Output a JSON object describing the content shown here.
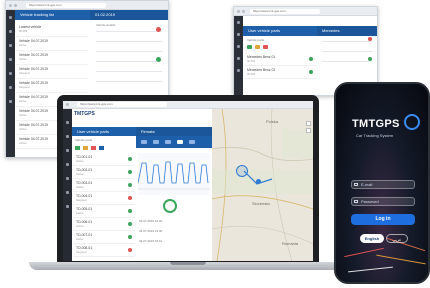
{
  "brand": {
    "logo_text": "TMTGPS",
    "tagline": "Car Tracking System",
    "accent": "#1d5fa8",
    "phone_accent": "#1e6ee0"
  },
  "window_left": {
    "url": "https://www.tmt-gps.com",
    "header_title": "Vehicle tracking list",
    "header_right": "01.02.2019",
    "panel_title": "Vehicle details",
    "rows": [
      {
        "title": "Lowest vehicle",
        "sub": "ID 004"
      },
      {
        "title": "Vehicle 04.07.2019",
        "sub": "Active"
      },
      {
        "title": "Vehicle 04.07.2019",
        "sub": "Active"
      },
      {
        "title": "Vehicle 04.07.2019",
        "sub": "Stopped"
      },
      {
        "title": "Vehicle 04.07.2019",
        "sub": "Stopped"
      },
      {
        "title": "Vehicle 04.07.2019",
        "sub": "Active"
      },
      {
        "title": "Vehicle 04.07.2019",
        "sub": "Active"
      },
      {
        "title": "Vehicle 04.07.2019",
        "sub": "Active"
      },
      {
        "title": "Vehicle 04.07.2019",
        "sub": "Active"
      }
    ]
  },
  "window_right": {
    "url": "https://www.tmt-gps.com",
    "header_title": "User vehicle parts",
    "header_title_2": "Mercedes",
    "filter_label": "Vehicle parts",
    "rows": [
      {
        "title": "Mercedes Benz 01",
        "sub": "ID 001"
      },
      {
        "title": "Mercedes Benz 02",
        "sub": "ID 002"
      }
    ]
  },
  "laptop": {
    "url": "https://www.tmt-gps.com",
    "panel_title": "User vehicle parts",
    "list_header": "Vehicle parts",
    "chart_title": "Firmata",
    "map_labels": [
      "Polska",
      "Slovensko",
      "Romania"
    ],
    "rows": [
      {
        "title": "TD-001-01",
        "sub": "Active"
      },
      {
        "title": "TD-002-01",
        "sub": "Active"
      },
      {
        "title": "TD-003-01",
        "sub": "Active"
      },
      {
        "title": "TD-004-01",
        "sub": "Stopped"
      },
      {
        "title": "TD-005-01",
        "sub": "Active"
      },
      {
        "title": "TD-006-01",
        "sub": "Active"
      },
      {
        "title": "TD-007-01",
        "sub": "Active"
      },
      {
        "title": "TD-008-01",
        "sub": "Stopped"
      }
    ],
    "detail_rows": [
      "04.07.2019 12:00",
      "04.07.2019 14:30",
      "04.07.2019 16:10"
    ]
  },
  "phone": {
    "email_placeholder": "E-mail",
    "password_placeholder": "Password",
    "login_label": "Log in",
    "lang_active": "English",
    "lang_other": "عربي"
  },
  "icons": [
    "lock-icon",
    "mail-icon",
    "truck-icon",
    "gear-icon",
    "map-pin-icon",
    "bell-icon",
    "close-icon"
  ]
}
